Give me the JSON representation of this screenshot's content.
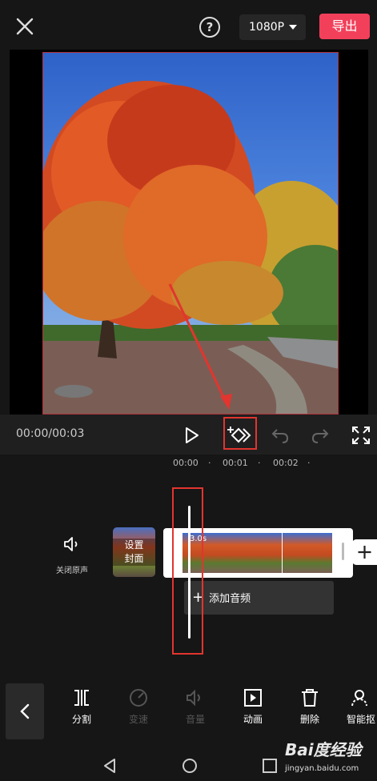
{
  "header": {
    "close_icon": "close-icon",
    "help_symbol": "?",
    "resolution": "1080P",
    "export_label": "导出"
  },
  "preview": {
    "image": "autumn-tree-photo"
  },
  "playback": {
    "timecode": "00:00/00:03",
    "icons": [
      "play-icon",
      "keyframe-icon",
      "undo-icon",
      "redo-icon",
      "fullscreen-icon"
    ]
  },
  "ruler": {
    "ticks": [
      "00:00",
      "00:01",
      "00:02"
    ]
  },
  "timeline": {
    "mute_label": "关闭原声",
    "cover_label_line1": "设置",
    "cover_label_line2": "封面",
    "clip_duration": "3.0s",
    "add_audio_label": "添加音频"
  },
  "toolbar": {
    "items": [
      {
        "label": "分割",
        "icon": "split-icon",
        "enabled": true
      },
      {
        "label": "变速",
        "icon": "speed-icon",
        "enabled": false
      },
      {
        "label": "音量",
        "icon": "volume-icon",
        "enabled": false
      },
      {
        "label": "动画",
        "icon": "animation-icon",
        "enabled": true
      },
      {
        "label": "删除",
        "icon": "delete-icon",
        "enabled": true
      },
      {
        "label": "智能抠",
        "icon": "smart-cutout-icon",
        "enabled": true
      }
    ]
  },
  "watermark": {
    "brand": "Bai度经验",
    "url": "jingyan.baidu.com"
  },
  "colors": {
    "accent": "#f2405b",
    "highlight_box": "#e2352f"
  }
}
